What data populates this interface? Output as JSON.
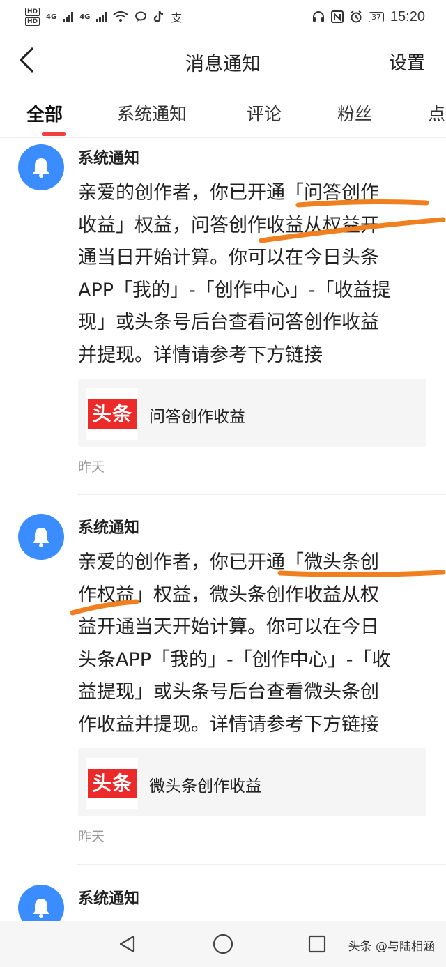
{
  "status_bar": {
    "hd1": "HD",
    "hd2": "HD",
    "signal1": "4G",
    "signal2": "4G",
    "battery": "37",
    "time": "15:20",
    "icons": [
      "wifi-icon",
      "chat-bubble-icon",
      "tiktok-icon",
      "alipay-icon",
      "headset-icon",
      "nfc-icon",
      "alarm-icon"
    ]
  },
  "header": {
    "title": "消息通知",
    "settings": "设置"
  },
  "tabs": [
    {
      "label": "全部",
      "active": true
    },
    {
      "label": "系统通知"
    },
    {
      "label": "评论"
    },
    {
      "label": "粉丝"
    },
    {
      "label": "点"
    }
  ],
  "messages": [
    {
      "sender": "系统通知",
      "lines": [
        "亲爱的创作者，你已开通「问答创作",
        "收益」权益，问答创作收益从权益开",
        "通当日开始计算。你可以在今日头条",
        "APP「我的」-「创作中心」-「收益提",
        "现」或头条号后台查看问答创作收益",
        "并提现。详情请参考下方链接"
      ],
      "card": {
        "logo": "头条",
        "title": "问答创作收益"
      },
      "time": "昨天"
    },
    {
      "sender": "系统通知",
      "lines": [
        "亲爱的创作者，你已开通「微头条创",
        "作权益」权益，微头条创作收益从权",
        "益开通当天开始计算。你可以在今日",
        "头条APP「我的」-「创作中心」-「收",
        "益提现」或头条号后台查看微头条创",
        "作收益并提现。详情请参考下方链接"
      ],
      "card": {
        "logo": "头条",
        "title": "微头条创作收益"
      },
      "time": "昨天"
    },
    {
      "sender": "系统通知"
    }
  ],
  "colors": {
    "accent": "#f04142",
    "avatar": "#3b8dff",
    "annotation": "#f0801f",
    "logo_red": "#ec2a2a"
  },
  "watermark": "头条 @与陆相涵"
}
